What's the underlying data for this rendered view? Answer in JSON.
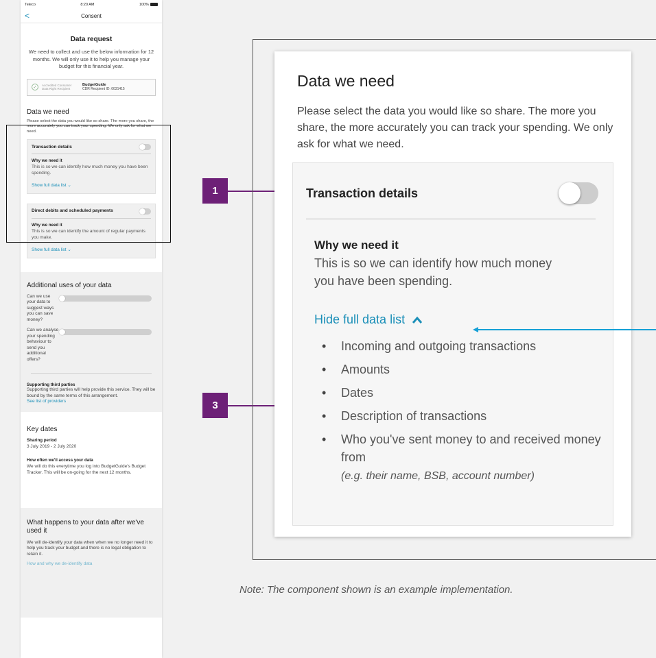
{
  "phone": {
    "status": {
      "carrier": "Teleco",
      "time": "8:20 AM",
      "battery": "100%"
    },
    "nav": {
      "back": "<",
      "title": "Consent"
    },
    "request": {
      "title": "Data request",
      "body": "We need to collect and use the below information for 12 months. We will only use it to help you manage your budget for this financial year.",
      "accred_label": "Accredited Consumer Data Right Recipient",
      "accred_name": "BudgetGuide",
      "accred_id": "CDR Recipient ID: 0031415"
    },
    "data_need": {
      "title": "Data we need",
      "intro": "Please select the data you would like so share. The more you share, the more accurately you can track your spending. We only ask for what we need.",
      "cards": [
        {
          "label": "Transaction details",
          "why_title": "Why we need it",
          "why_body": "This is so we can identify how much money you have been spending.",
          "link": "Show full data list"
        },
        {
          "label": "Direct debits and scheduled payments",
          "why_title": "Why we need it",
          "why_body": "This is so we can identify the amount of regular payments you make.",
          "link": "Show full data list"
        }
      ]
    },
    "additional": {
      "title": "Additional uses of your data",
      "q1": "Can we use your data to suggest ways you can save money?",
      "q2": "Can we analyse your spending behaviour to send you additional offers?",
      "third_title": "Supporting third parties",
      "third_body": "Supporting third parties will help provide this service. They will be bound by the same terms of this arrangement.",
      "third_link": "See list of providers"
    },
    "key_dates": {
      "title": "Key dates",
      "period_label": "Sharing period",
      "period_value": "3 July 2019 - 2 July 2020",
      "often_label": "How often we'll access your data",
      "often_body": "We will do this everytime you log into BudgetGuide's Budget Tracker. This will be on-going for the next 12 months."
    },
    "after": {
      "title": "What happens to your data after we've used it",
      "body": "We will de-identify your data when when we no longer need it to help you track your budget and there is no legal obligation to retain it.",
      "link": "How and why we de-identify data"
    }
  },
  "callouts": {
    "one": "1",
    "three": "3"
  },
  "zoom": {
    "title": "Data we need",
    "intro": "Please select the data you would like so share. The more you share, the more accurately you can track your spending. We only ask for what we need.",
    "item_label": "Transaction details",
    "why_title": "Why we need it",
    "why_body": "This is so we can identify how much money you have been spending.",
    "hide_link": "Hide full data list",
    "list": [
      "Incoming and outgoing transactions",
      "Amounts",
      "Dates",
      "Description of transactions",
      "Who you've sent money to and received money from"
    ],
    "list_note": "(e.g. their name, BSB, account number)"
  },
  "note": "Note: The component shown is an example implementation.",
  "colors": {
    "accent": "#6d2077",
    "link": "#1b8fb8",
    "arrow_blue": "#16a0d6"
  }
}
